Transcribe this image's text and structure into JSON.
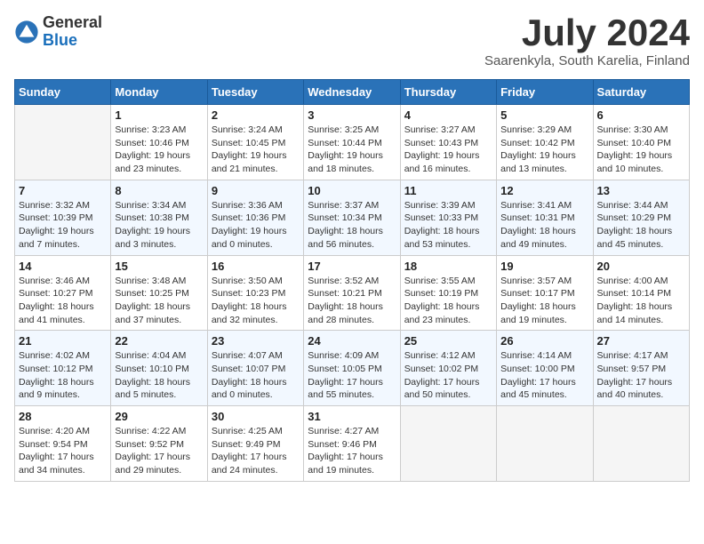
{
  "header": {
    "logo_general": "General",
    "logo_blue": "Blue",
    "month_title": "July 2024",
    "subtitle": "Saarenkyla, South Karelia, Finland"
  },
  "days_of_week": [
    "Sunday",
    "Monday",
    "Tuesday",
    "Wednesday",
    "Thursday",
    "Friday",
    "Saturday"
  ],
  "weeks": [
    [
      {
        "day": "",
        "details": ""
      },
      {
        "day": "1",
        "details": "Sunrise: 3:23 AM\nSunset: 10:46 PM\nDaylight: 19 hours\nand 23 minutes."
      },
      {
        "day": "2",
        "details": "Sunrise: 3:24 AM\nSunset: 10:45 PM\nDaylight: 19 hours\nand 21 minutes."
      },
      {
        "day": "3",
        "details": "Sunrise: 3:25 AM\nSunset: 10:44 PM\nDaylight: 19 hours\nand 18 minutes."
      },
      {
        "day": "4",
        "details": "Sunrise: 3:27 AM\nSunset: 10:43 PM\nDaylight: 19 hours\nand 16 minutes."
      },
      {
        "day": "5",
        "details": "Sunrise: 3:29 AM\nSunset: 10:42 PM\nDaylight: 19 hours\nand 13 minutes."
      },
      {
        "day": "6",
        "details": "Sunrise: 3:30 AM\nSunset: 10:40 PM\nDaylight: 19 hours\nand 10 minutes."
      }
    ],
    [
      {
        "day": "7",
        "details": "Sunrise: 3:32 AM\nSunset: 10:39 PM\nDaylight: 19 hours\nand 7 minutes."
      },
      {
        "day": "8",
        "details": "Sunrise: 3:34 AM\nSunset: 10:38 PM\nDaylight: 19 hours\nand 3 minutes."
      },
      {
        "day": "9",
        "details": "Sunrise: 3:36 AM\nSunset: 10:36 PM\nDaylight: 19 hours\nand 0 minutes."
      },
      {
        "day": "10",
        "details": "Sunrise: 3:37 AM\nSunset: 10:34 PM\nDaylight: 18 hours\nand 56 minutes."
      },
      {
        "day": "11",
        "details": "Sunrise: 3:39 AM\nSunset: 10:33 PM\nDaylight: 18 hours\nand 53 minutes."
      },
      {
        "day": "12",
        "details": "Sunrise: 3:41 AM\nSunset: 10:31 PM\nDaylight: 18 hours\nand 49 minutes."
      },
      {
        "day": "13",
        "details": "Sunrise: 3:44 AM\nSunset: 10:29 PM\nDaylight: 18 hours\nand 45 minutes."
      }
    ],
    [
      {
        "day": "14",
        "details": "Sunrise: 3:46 AM\nSunset: 10:27 PM\nDaylight: 18 hours\nand 41 minutes."
      },
      {
        "day": "15",
        "details": "Sunrise: 3:48 AM\nSunset: 10:25 PM\nDaylight: 18 hours\nand 37 minutes."
      },
      {
        "day": "16",
        "details": "Sunrise: 3:50 AM\nSunset: 10:23 PM\nDaylight: 18 hours\nand 32 minutes."
      },
      {
        "day": "17",
        "details": "Sunrise: 3:52 AM\nSunset: 10:21 PM\nDaylight: 18 hours\nand 28 minutes."
      },
      {
        "day": "18",
        "details": "Sunrise: 3:55 AM\nSunset: 10:19 PM\nDaylight: 18 hours\nand 23 minutes."
      },
      {
        "day": "19",
        "details": "Sunrise: 3:57 AM\nSunset: 10:17 PM\nDaylight: 18 hours\nand 19 minutes."
      },
      {
        "day": "20",
        "details": "Sunrise: 4:00 AM\nSunset: 10:14 PM\nDaylight: 18 hours\nand 14 minutes."
      }
    ],
    [
      {
        "day": "21",
        "details": "Sunrise: 4:02 AM\nSunset: 10:12 PM\nDaylight: 18 hours\nand 9 minutes."
      },
      {
        "day": "22",
        "details": "Sunrise: 4:04 AM\nSunset: 10:10 PM\nDaylight: 18 hours\nand 5 minutes."
      },
      {
        "day": "23",
        "details": "Sunrise: 4:07 AM\nSunset: 10:07 PM\nDaylight: 18 hours\nand 0 minutes."
      },
      {
        "day": "24",
        "details": "Sunrise: 4:09 AM\nSunset: 10:05 PM\nDaylight: 17 hours\nand 55 minutes."
      },
      {
        "day": "25",
        "details": "Sunrise: 4:12 AM\nSunset: 10:02 PM\nDaylight: 17 hours\nand 50 minutes."
      },
      {
        "day": "26",
        "details": "Sunrise: 4:14 AM\nSunset: 10:00 PM\nDaylight: 17 hours\nand 45 minutes."
      },
      {
        "day": "27",
        "details": "Sunrise: 4:17 AM\nSunset: 9:57 PM\nDaylight: 17 hours\nand 40 minutes."
      }
    ],
    [
      {
        "day": "28",
        "details": "Sunrise: 4:20 AM\nSunset: 9:54 PM\nDaylight: 17 hours\nand 34 minutes."
      },
      {
        "day": "29",
        "details": "Sunrise: 4:22 AM\nSunset: 9:52 PM\nDaylight: 17 hours\nand 29 minutes."
      },
      {
        "day": "30",
        "details": "Sunrise: 4:25 AM\nSunset: 9:49 PM\nDaylight: 17 hours\nand 24 minutes."
      },
      {
        "day": "31",
        "details": "Sunrise: 4:27 AM\nSunset: 9:46 PM\nDaylight: 17 hours\nand 19 minutes."
      },
      {
        "day": "",
        "details": ""
      },
      {
        "day": "",
        "details": ""
      },
      {
        "day": "",
        "details": ""
      }
    ]
  ]
}
